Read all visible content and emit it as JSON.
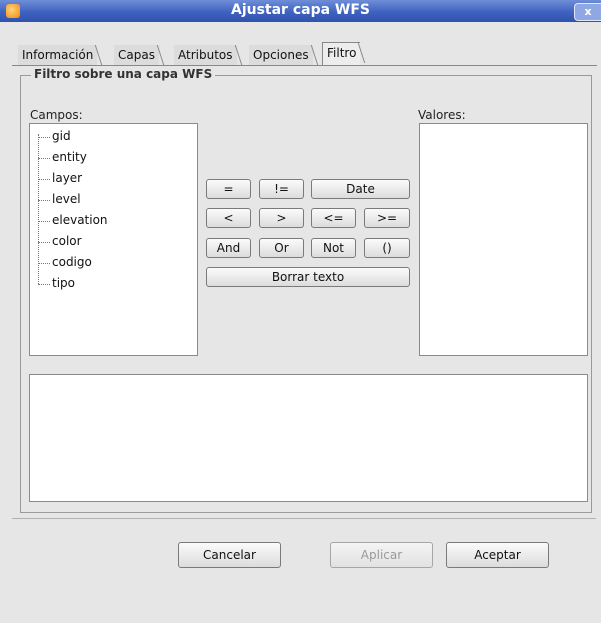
{
  "window": {
    "title": "Ajustar capa WFS",
    "close_label": "x"
  },
  "tabs": [
    {
      "label": "Información"
    },
    {
      "label": "Capas"
    },
    {
      "label": "Atributos"
    },
    {
      "label": "Opciones"
    },
    {
      "label": "Filtro",
      "active": true
    }
  ],
  "filter": {
    "group_title": "Filtro sobre una capa WFS",
    "fields_label": "Campos:",
    "values_label": "Valores:",
    "fields": [
      "gid",
      "entity",
      "layer",
      "level",
      "elevation",
      "color",
      "codigo",
      "tipo"
    ],
    "query_text": "",
    "operators": {
      "eq": "=",
      "ne": "!=",
      "date": "Date",
      "lt": "<",
      "gt": ">",
      "le": "<=",
      "ge": ">=",
      "and": "And",
      "or": "Or",
      "not": "Not",
      "paren": "()",
      "clear": "Borrar texto"
    }
  },
  "footer": {
    "cancel": "Cancelar",
    "apply": "Aplicar",
    "accept": "Aceptar"
  }
}
